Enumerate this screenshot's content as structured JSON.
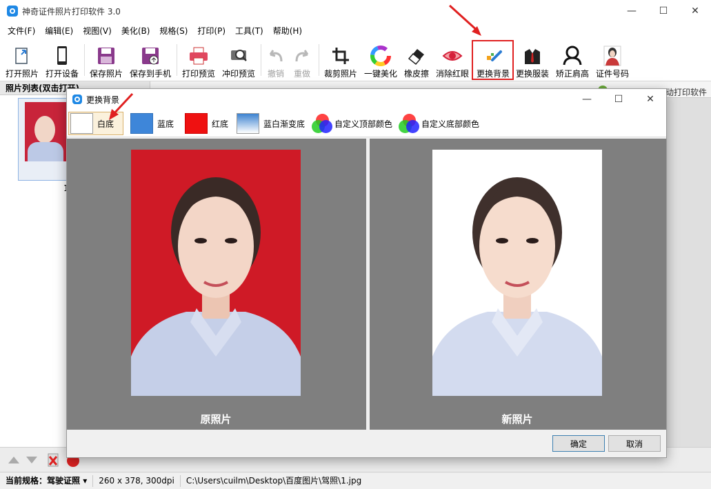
{
  "window": {
    "title": "神奇证件照片打印软件 3.0",
    "min": "—",
    "max": "☐",
    "close": "✕"
  },
  "menu": [
    "文件(F)",
    "编辑(E)",
    "视图(V)",
    "美化(B)",
    "规格(S)",
    "打印(P)",
    "工具(T)",
    "帮助(H)"
  ],
  "toolbar": {
    "open_photo": "打开照片",
    "open_device": "打开设备",
    "save_photo": "保存照片",
    "save_to_phone": "保存到手机",
    "print_preview": "打印预览",
    "develop_preview": "冲印预览",
    "undo": "撤销",
    "redo": "重做",
    "crop": "裁剪照片",
    "one_click_beautify": "一键美化",
    "eraser": "橡皮擦",
    "remove_red_eye": "消除红眼",
    "change_background": "更换背景",
    "change_clothes": "更换服装",
    "fix_shoulders": "矫正肩高",
    "id_number": "证件号码"
  },
  "left_panel": {
    "title": "照片列表(双击打开)",
    "thumb_label": "1"
  },
  "right_panel": {
    "tab_text": "动打印软件"
  },
  "status": {
    "spec_label": "当前规格：",
    "spec_value": "驾驶证照",
    "size": "260 x 378, 300dpi",
    "path": "C:\\Users\\cuilm\\Desktop\\百度图片\\驾照\\1.jpg"
  },
  "dialog": {
    "title": "更换背景",
    "options": {
      "white": "白底",
      "blue": "蓝底",
      "red": "红底",
      "gradient": "蓝白渐变底",
      "custom_top": "自定义顶部颜色",
      "custom_bottom": "自定义底部颜色"
    },
    "original_caption": "原照片",
    "new_caption": "新照片",
    "ok": "确定",
    "cancel": "取消"
  },
  "colors": {
    "white": "#ffffff",
    "blue": "#3e86d9",
    "red": "#ef1111",
    "original_bg": "#cf1a26",
    "highlight": "#e02020"
  }
}
